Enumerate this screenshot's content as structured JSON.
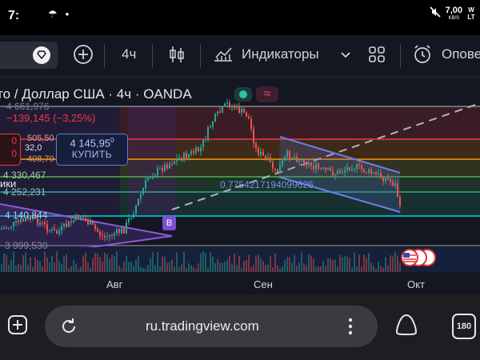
{
  "status_bar": {
    "time": "7:",
    "net_speed": "7,00",
    "net_unit": "KB/S",
    "right_labels": "W LT"
  },
  "toolbar": {
    "add_symbol_icon": "plus-circle-icon",
    "interval": "4ч",
    "chart_type_icon": "candles-icon",
    "indicators_label": "Индикаторы",
    "more_icon": "chevron-down-icon",
    "layouts_icon": "grid-icon",
    "alerts_label": "Опове"
  },
  "chart": {
    "title": "то / Доллар США · 4ч · OANDA",
    "change": "−139,145 (−3,25%)",
    "sell_price": "0",
    "sell_price_top": "0",
    "spread": "32,0",
    "buy_price": "4 145,95",
    "buy_price_sup": "0",
    "buy_label": "КУПИТЬ",
    "levels_left": [
      "4 661,976",
      "505,50",
      "408,70",
      "4 330,467",
      "4 252,231",
      "4 140,844",
      "3 999,530"
    ],
    "indicator_label": "ики",
    "fib_value": "0.7754217194099626",
    "marker": "B",
    "colors": {
      "bg": "#131722",
      "up": "#26a69a",
      "down": "#ef5350",
      "channel": "#5b6fd6",
      "accent": "#2962ff"
    }
  },
  "xaxis": {
    "labels": [
      "Авг",
      "Сен",
      "Окт"
    ]
  },
  "browser": {
    "new_tab_icon": "plus-square-icon",
    "reload_icon": "reload-icon",
    "url": "ru.tradingview.com",
    "menu_icon": "kebab-menu-icon",
    "assistant_icon": "assistant-icon",
    "tabs_count": "180"
  }
}
